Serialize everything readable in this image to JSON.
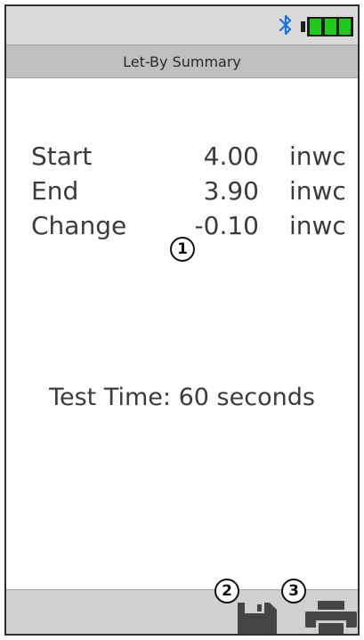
{
  "status": {
    "bluetooth_icon": "bluetooth-icon",
    "battery_icon": "battery-full-icon",
    "battery_level": 1.0,
    "bluetooth_color": "#1e73d8",
    "battery_fill_color": "#22c81e"
  },
  "header": {
    "title": "Let-By Summary"
  },
  "readings": [
    {
      "label": "Start",
      "value": "4.00",
      "unit": "inwc"
    },
    {
      "label": "End",
      "value": "3.90",
      "unit": "inwc"
    },
    {
      "label": "Change",
      "value": "-0.10",
      "unit": "inwc"
    }
  ],
  "test_time": "Test Time: 60 seconds",
  "callouts": {
    "one": "1",
    "two": "2",
    "three": "3"
  },
  "toolbar": {
    "save_icon": "floppy-disk-icon",
    "print_icon": "printer-icon"
  }
}
